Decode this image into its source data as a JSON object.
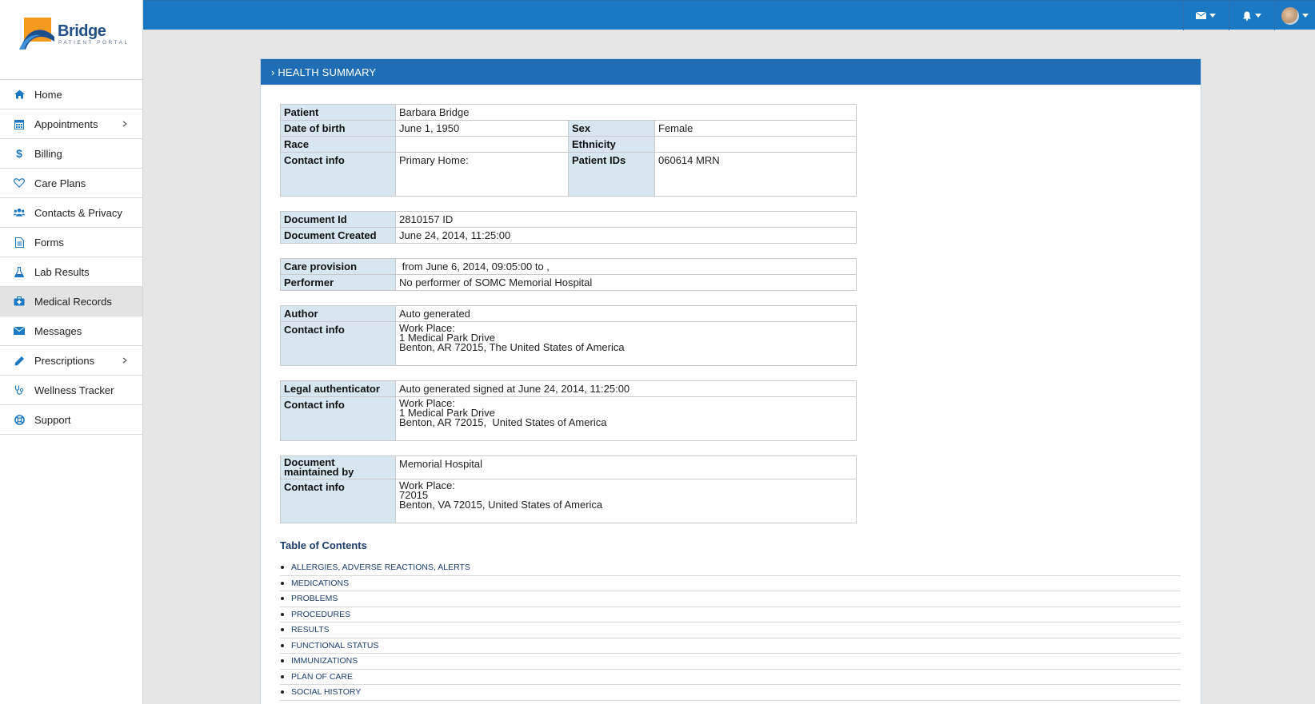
{
  "brand": {
    "name": "Bridge",
    "subtitle": "PATIENT PORTAL"
  },
  "sidebar": {
    "items": [
      {
        "label": "Home",
        "icon": "home-icon"
      },
      {
        "label": "Appointments",
        "icon": "calendar-icon",
        "has_submenu": true
      },
      {
        "label": "Billing",
        "icon": "dollar-icon"
      },
      {
        "label": "Care Plans",
        "icon": "heart-icon"
      },
      {
        "label": "Contacts & Privacy",
        "icon": "users-icon"
      },
      {
        "label": "Forms",
        "icon": "document-icon"
      },
      {
        "label": "Lab Results",
        "icon": "flask-icon"
      },
      {
        "label": "Medical Records",
        "icon": "medkit-icon",
        "active": true
      },
      {
        "label": "Messages",
        "icon": "envelope-icon"
      },
      {
        "label": "Prescriptions",
        "icon": "pencil-icon",
        "has_submenu": true
      },
      {
        "label": "Wellness Tracker",
        "icon": "stethoscope-icon"
      },
      {
        "label": "Support",
        "icon": "lifebuoy-icon"
      }
    ]
  },
  "topbar": {
    "icons": [
      "envelope-icon",
      "bell-icon",
      "avatar"
    ]
  },
  "panel": {
    "title": "› HEALTH SUMMARY"
  },
  "patient": {
    "patient_label": "Patient",
    "patient_value": "Barbara Bridge",
    "dob_label": "Date of birth",
    "dob_value": "June 1, 1950",
    "sex_label": "Sex",
    "sex_value": "Female",
    "race_label": "Race",
    "race_value": "",
    "ethnicity_label": "Ethnicity",
    "ethnicity_value": "",
    "contact_label": "Contact info",
    "contact_value": "Primary Home:",
    "ids_label": "Patient IDs",
    "ids_value": "060614 MRN"
  },
  "document": {
    "id_label": "Document Id",
    "id_value": "2810157 ID",
    "created_label": "Document Created",
    "created_value": "June 24, 2014, 11:25:00"
  },
  "care": {
    "provision_label": "Care provision",
    "provision_value": " from June 6, 2014, 09:05:00 to ,",
    "performer_label": "Performer",
    "performer_value": "No performer of SOMC Memorial Hospital"
  },
  "author": {
    "author_label": "Author",
    "author_value": "Auto generated",
    "contact_label": "Contact info",
    "contact_lines": [
      "Work Place:",
      "1 Medical Park Drive",
      "Benton, AR 72015, The United States of America"
    ]
  },
  "legal": {
    "label": "Legal authenticator",
    "value": "Auto generated signed at June 24, 2014, 11:25:00",
    "contact_label": "Contact info",
    "contact_lines": [
      "Work Place:",
      "1 Medical Park Drive",
      "Benton, AR 72015,  United States of America"
    ]
  },
  "custodian": {
    "label": "Document maintained by",
    "value": "Memorial Hospital",
    "contact_label": "Contact info",
    "contact_lines": [
      "Work Place:",
      "72015",
      "Benton, VA 72015, United States of America"
    ]
  },
  "toc": {
    "title": "Table of Contents",
    "items": [
      "ALLERGIES, ADVERSE REACTIONS, ALERTS",
      "MEDICATIONS",
      "PROBLEMS",
      "PROCEDURES",
      "RESULTS",
      "FUNCTIONAL STATUS",
      "IMMUNIZATIONS",
      "PLAN OF CARE",
      "SOCIAL HISTORY"
    ]
  }
}
